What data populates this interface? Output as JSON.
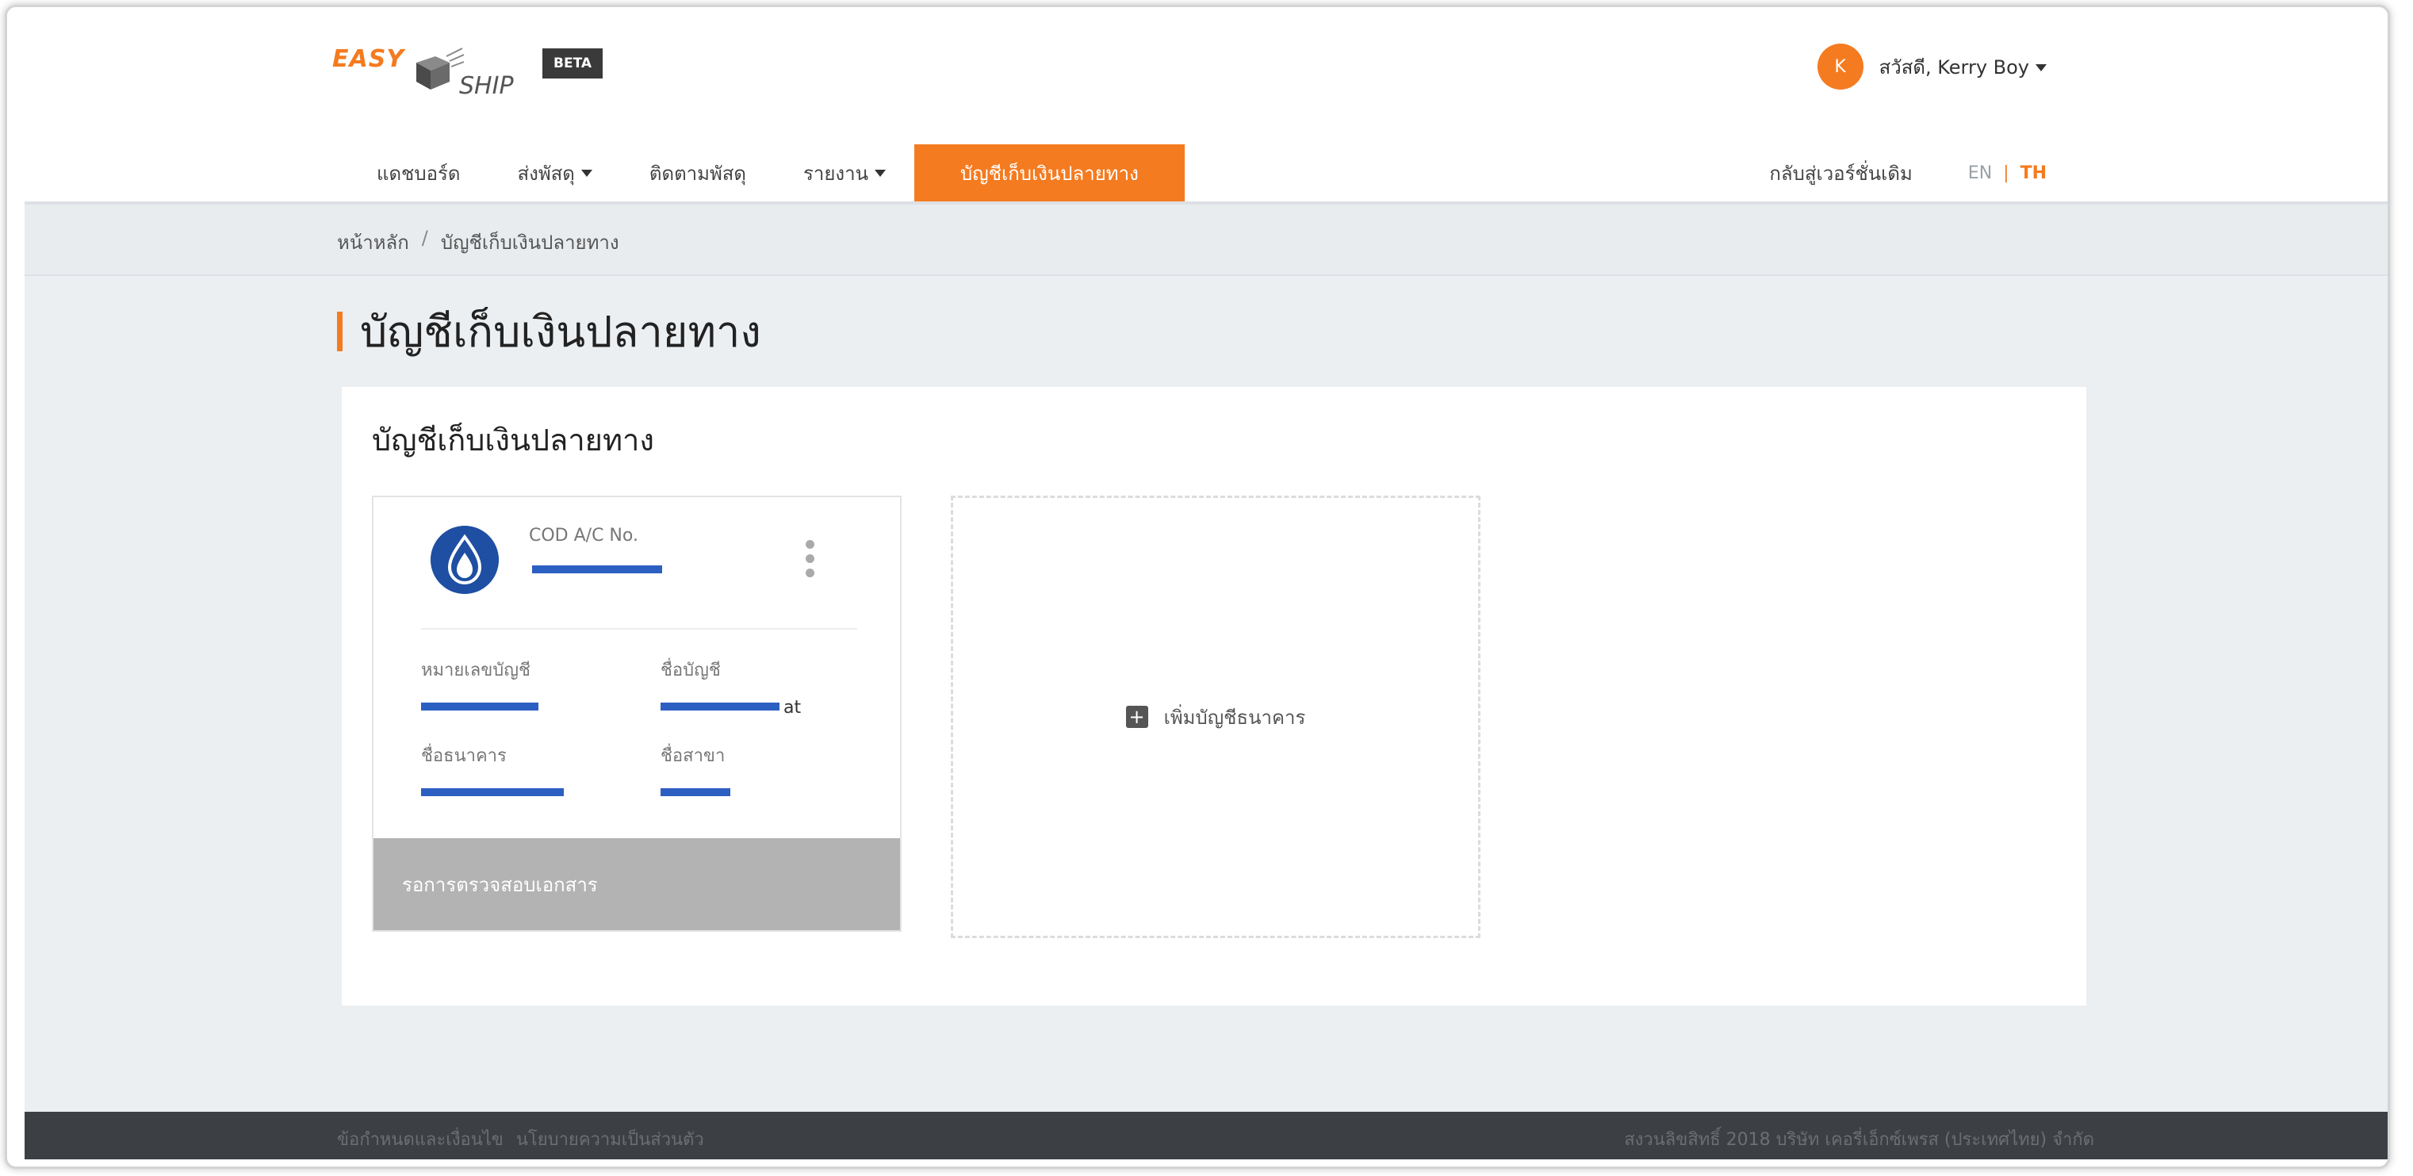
{
  "header": {
    "logo": {
      "easy": "EASY",
      "ship": "SHIP"
    },
    "beta_badge": "BETA",
    "user": {
      "avatar_initial": "K",
      "greeting": "สวัสดี, Kerry Boy"
    },
    "nav": [
      {
        "label": "แดชบอร์ด",
        "dropdown": false,
        "active": false
      },
      {
        "label": "ส่งพัสดุ",
        "dropdown": true,
        "active": false
      },
      {
        "label": "ติดตามพัสดุ",
        "dropdown": false,
        "active": false
      },
      {
        "label": "รายงาน",
        "dropdown": true,
        "active": false
      },
      {
        "label": "บัญชีเก็บเงินปลายทาง",
        "dropdown": false,
        "active": true
      }
    ],
    "back_to_old": "กลับสู่เวอร์ชั่นเดิม",
    "lang": {
      "en": "EN",
      "sep": "|",
      "th": "TH"
    }
  },
  "breadcrumb": {
    "home": "หน้าหลัก",
    "sep": "/",
    "current": "บัญชีเก็บเงินปลายทาง"
  },
  "page_title": "บัญชีเก็บเงินปลายทาง",
  "panel": {
    "title": "บัญชีเก็บเงินปลายทาง",
    "account_card": {
      "cod_label": "COD A/C No.",
      "cod_value": "",
      "fields": {
        "account_number_label": "หมายเลขบัญชี",
        "account_number_value": "",
        "account_name_label": "ชื่อบัญชี",
        "account_name_value": "at",
        "bank_name_label": "ชื่อธนาคาร",
        "bank_name_value": "",
        "branch_label": "ชื่อสาขา",
        "branch_value": ""
      },
      "status": "รอการตรวจสอบเอกสาร"
    },
    "add_account_label": "เพิ่มบัญชีธนาคาร"
  },
  "footer": {
    "terms": "ข้อกำหนดและเงื่อนไข",
    "privacy": "นโยบายความเป็นส่วนตัว",
    "copyright": "สงวนลิขสิทธิ์ 2018 บริษัท เคอรี่เอ็กซ์เพรส (ประเทศไทย) จำกัด"
  },
  "colors": {
    "brand_orange": "#f47b20",
    "bank_blue": "#1e4fa3",
    "status_gray": "#b3b3b3",
    "footer_dark": "#3c3f43"
  },
  "icons": [
    "box-logo-icon",
    "chevron-down-icon",
    "bank-logo-icon",
    "kebab-menu-icon",
    "plus-square-icon"
  ]
}
